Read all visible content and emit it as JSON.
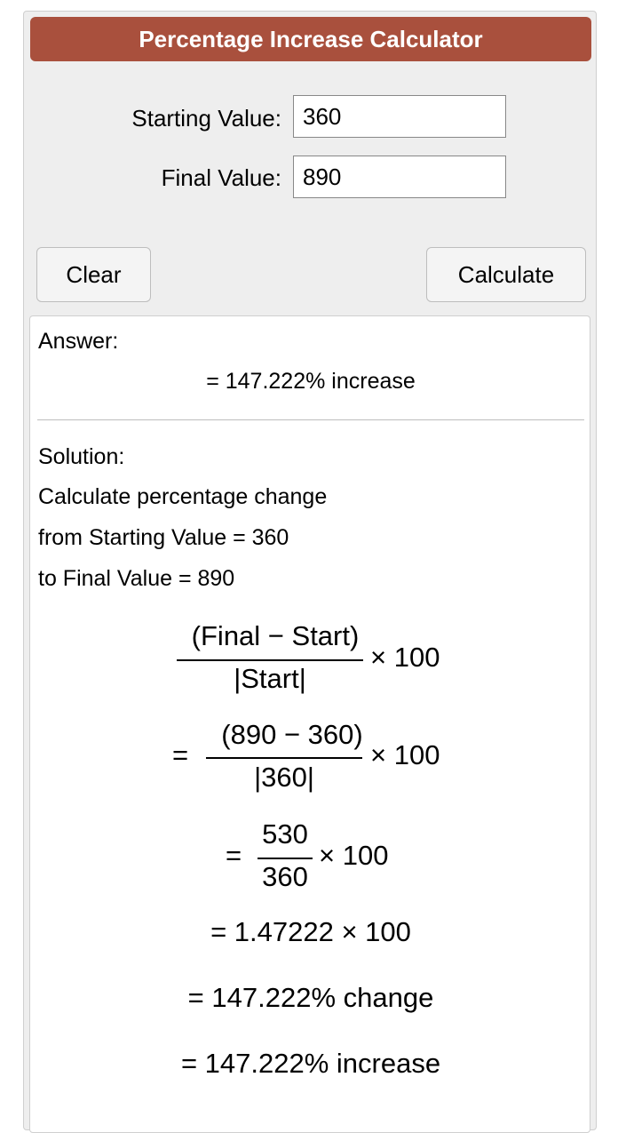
{
  "title": "Percentage Increase Calculator",
  "form": {
    "starting_label": "Starting Value:",
    "starting_value": "360",
    "final_label": "Final Value:",
    "final_value": "890",
    "clear_label": "Clear",
    "calculate_label": "Calculate"
  },
  "answer": {
    "heading": "Answer:",
    "value": "= 147.222% increase"
  },
  "solution": {
    "heading": "Solution:",
    "line1": "Calculate percentage change",
    "line2": "from Starting Value = 360",
    "line3": "to Final Value = 890",
    "formula_numerator": "(Final − Start)",
    "formula_denominator": "|Start|",
    "times_100": "× 100",
    "eq": "=",
    "step1_numerator": "(890 − 360)",
    "step1_denominator": "|360|",
    "step2_numerator": "530",
    "step2_denominator": "360",
    "step3": "= 1.47222 × 100",
    "step4": "= 147.222% change",
    "step5": "= 147.222% increase"
  }
}
